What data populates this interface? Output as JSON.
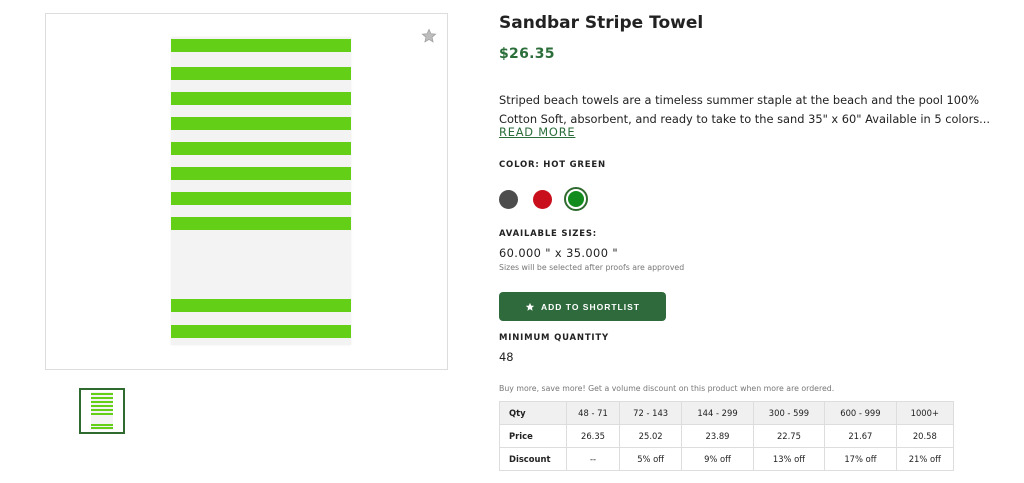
{
  "product": {
    "title": "Sandbar Stripe Towel",
    "price": "$26.35",
    "description_line1": "Striped beach towels are a timeless summer staple at the beach and the pool 100%",
    "description_line2": "Cotton Soft, absorbent, and ready to take to the sand 35\" x 60\" Available in 5 colors...",
    "read_more": "READ MORE",
    "color_label": "COLOR: HOT GREEN",
    "colors": [
      {
        "name": "gray",
        "hex": "#4d4d4d"
      },
      {
        "name": "red",
        "hex": "#c90f1c"
      },
      {
        "name": "hot-green",
        "hex": "#128c1c",
        "selected": true
      }
    ],
    "sizes_label": "AVAILABLE SIZES:",
    "size_value": "60.000 \" x 35.000 \"",
    "size_note": "Sizes will be selected after proofs are approved",
    "shortlist_button": "ADD TO SHORTLIST",
    "min_qty_label": "MINIMUM QUANTITY",
    "min_qty_value": "48",
    "bulk_note": "Buy more, save more! Get a volume discount on this product when more are ordered."
  },
  "image": {
    "accent": "#63cf17",
    "favorite_icon": "star-icon"
  },
  "pricing_table": {
    "qty_label": "Qty",
    "price_label": "Price",
    "discount_label": "Discount",
    "qty": [
      "48 - 71",
      "72 - 143",
      "144 - 299",
      "300 - 599",
      "600 - 999",
      "1000+"
    ],
    "price": [
      "26.35",
      "25.02",
      "23.89",
      "22.75",
      "21.67",
      "20.58"
    ],
    "discount": [
      "--",
      "5% off",
      "9% off",
      "13% off",
      "17% off",
      "21% off"
    ]
  }
}
